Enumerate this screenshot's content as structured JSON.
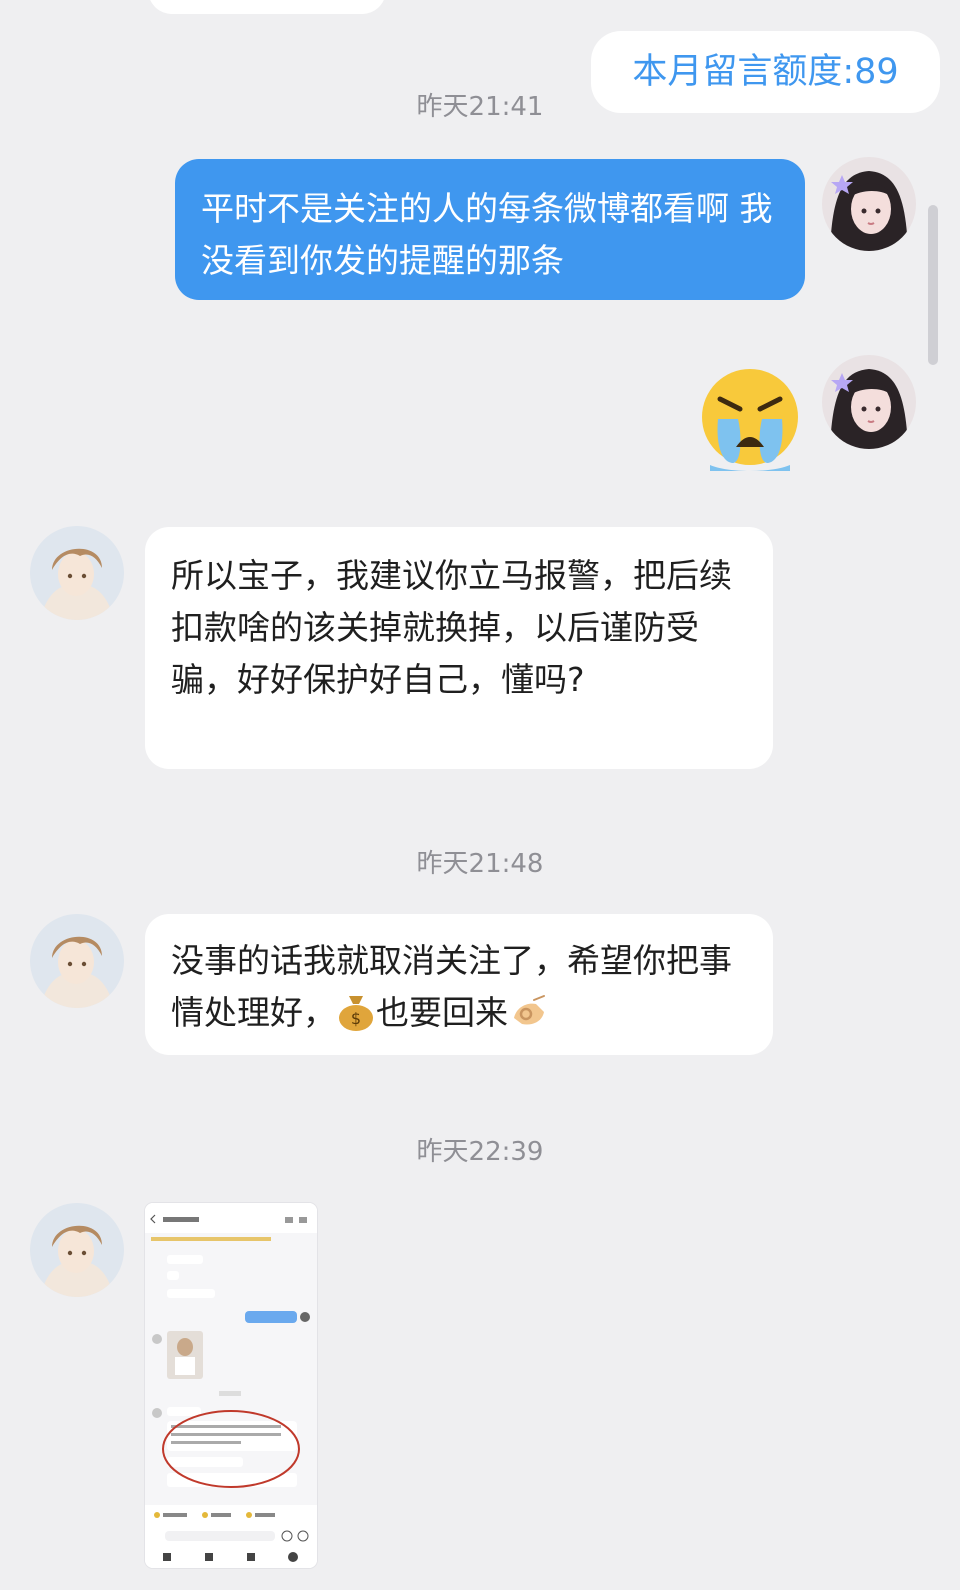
{
  "messages": {
    "quota": "本月留言额度:89",
    "time1": "昨天21:41",
    "out_text": "平时不是关注的人的每条微博都看啊 我没看到你发的提醒的那条",
    "in_text1": "所以宝子，我建议你立马报警，把后续扣款啥的该关掉就换掉，以后谨防受骗，好好保护好自己，懂吗?",
    "time2": "昨天21:48",
    "in_text2_a": "没事的话我就取消关注了，希望你把事情处理好，",
    "in_text2_b": "也要回来",
    "time3": "昨天22:39"
  },
  "icons": {
    "crying_emoji": "crying-face-emoji",
    "money_bag": "money-bag-emoji",
    "ok_hand": "ok-hand-emoji"
  },
  "colors": {
    "background": "#efeff1",
    "outgoing_bubble": "#3f97ef",
    "quota_text": "#3f97ef",
    "incoming_bubble": "#ffffff",
    "timestamp": "#8f8f95"
  }
}
